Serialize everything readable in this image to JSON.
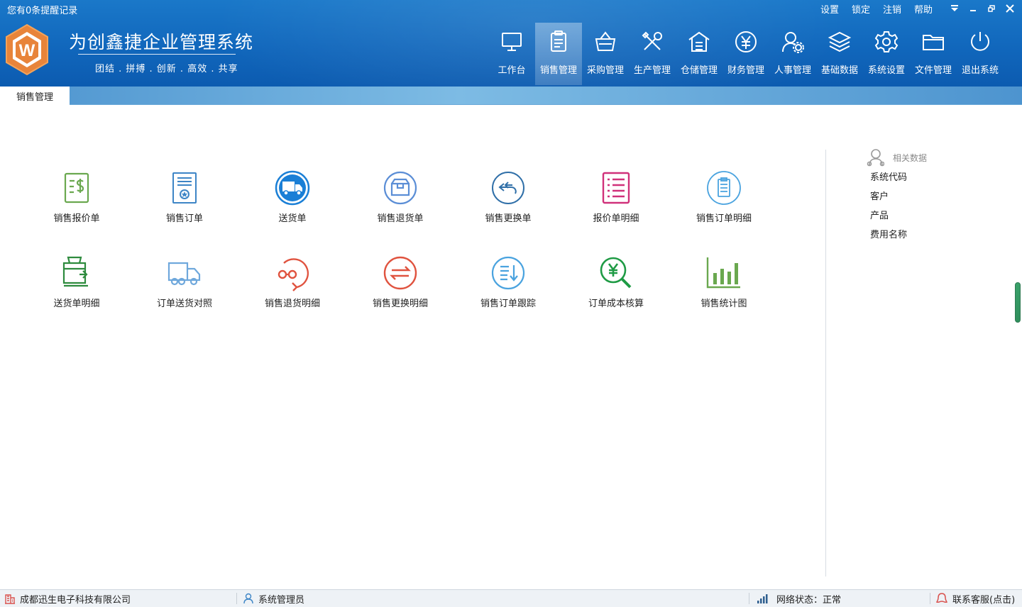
{
  "header": {
    "reminder": "您有0条提醒记录",
    "top_links": [
      "设置",
      "锁定",
      "注销",
      "帮助"
    ],
    "brand_title": "为创鑫捷企业管理系统",
    "brand_slogan": "团结 . 拼搏 . 创新 . 高效 . 共享",
    "logo_letter": "W"
  },
  "nav": [
    {
      "label": "工作台",
      "icon": "monitor-icon"
    },
    {
      "label": "销售管理",
      "icon": "clipboard-icon",
      "active": true
    },
    {
      "label": "采购管理",
      "icon": "basket-icon"
    },
    {
      "label": "生产管理",
      "icon": "tools-icon"
    },
    {
      "label": "仓储管理",
      "icon": "warehouse-icon"
    },
    {
      "label": "财务管理",
      "icon": "yuan-icon"
    },
    {
      "label": "人事管理",
      "icon": "user-gear-icon"
    },
    {
      "label": "基础数据",
      "icon": "layers-icon"
    },
    {
      "label": "系统设置",
      "icon": "gear-icon"
    },
    {
      "label": "文件管理",
      "icon": "folder-icon"
    },
    {
      "label": "退出系统",
      "icon": "power-icon"
    }
  ],
  "tab": {
    "label": "销售管理"
  },
  "modules": [
    {
      "label": "销售报价单",
      "icon": "quote-dollar-icon",
      "color": "#6aa84f"
    },
    {
      "label": "销售订单",
      "icon": "certificate-icon",
      "color": "#3d85c6"
    },
    {
      "label": "送货单",
      "icon": "truck-circle-icon",
      "color": "#1a7fd6"
    },
    {
      "label": "销售退货单",
      "icon": "return-box-icon",
      "color": "#5b8ed6"
    },
    {
      "label": "销售更换单",
      "icon": "exchange-arrow-icon",
      "color": "#2f6fa8"
    },
    {
      "label": "报价单明细",
      "icon": "list-detail-icon",
      "color": "#d0317a"
    },
    {
      "label": "销售订单明细",
      "icon": "order-detail-icon",
      "color": "#4aa3df"
    },
    {
      "label": "送货单明细",
      "icon": "delivery-box-icon",
      "color": "#2e8b3e"
    },
    {
      "label": "订单送货对照",
      "icon": "truck-outline-icon",
      "color": "#6fa8dc"
    },
    {
      "label": "销售退货明细",
      "icon": "return-glasses-icon",
      "color": "#e0533f"
    },
    {
      "label": "销售更换明细",
      "icon": "swap-circle-icon",
      "color": "#e0533f"
    },
    {
      "label": "销售订单跟踪",
      "icon": "track-list-icon",
      "color": "#4aa3df"
    },
    {
      "label": "订单成本核算",
      "icon": "cost-search-icon",
      "color": "#1f9b45"
    },
    {
      "label": "销售统计图",
      "icon": "bar-chart-icon",
      "color": "#6aa84f"
    }
  ],
  "related": {
    "title": "相关数据",
    "items": [
      "系统代码",
      "客户",
      "产品",
      "费用名称"
    ]
  },
  "status": {
    "company": "成都迅生电子科技有限公司",
    "user": "系统管理员",
    "network": "网络状态：正常",
    "support": "联系客服(点击)"
  }
}
